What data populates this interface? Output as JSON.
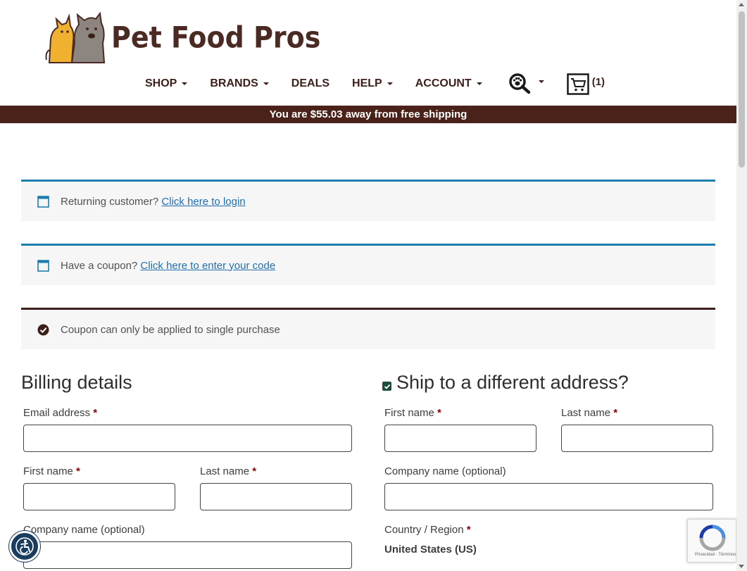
{
  "header": {
    "logo_text": "Pet Food Pros",
    "nav": [
      {
        "label": "SHOP",
        "has_caret": true
      },
      {
        "label": "BRANDS",
        "has_caret": true
      },
      {
        "label": "DEALS",
        "has_caret": false
      },
      {
        "label": "HELP",
        "has_caret": true
      },
      {
        "label": "ACCOUNT",
        "has_caret": true
      }
    ],
    "search_icon": "paw-search-icon",
    "cart_icon": "cart-icon",
    "cart_count": "(1)"
  },
  "shipping_bar": {
    "text": "You are $55.03 away from free shipping"
  },
  "notices": {
    "login": {
      "prefix": "Returning customer? ",
      "link": "Click here to login"
    },
    "coupon": {
      "prefix": "Have a coupon? ",
      "link": "Click here to enter your code"
    },
    "coupon_rule": {
      "text": "Coupon can only be applied to single purchase"
    }
  },
  "billing": {
    "title": "Billing details",
    "email_label": "Email address",
    "first_name_label": "First name",
    "last_name_label": "Last name",
    "company_label": "Company name (optional)",
    "email_value": "",
    "first_name_value": "",
    "last_name_value": "",
    "company_value": ""
  },
  "shipping": {
    "title": "Ship to a different address?",
    "checked": true,
    "first_name_label": "First name",
    "last_name_label": "Last name",
    "company_label": "Company name (optional)",
    "country_label": "Country / Region",
    "country_value": "United States (US)",
    "first_name_value": "",
    "last_name_value": "",
    "company_value": ""
  },
  "required_marker": "*",
  "recaptcha": {
    "text": "Privacidad - Términos"
  },
  "colors": {
    "brand_brown": "#4a2219",
    "info_blue": "#1e7fae",
    "link_blue": "#1e6fb0",
    "required_red": "#8b0000"
  }
}
